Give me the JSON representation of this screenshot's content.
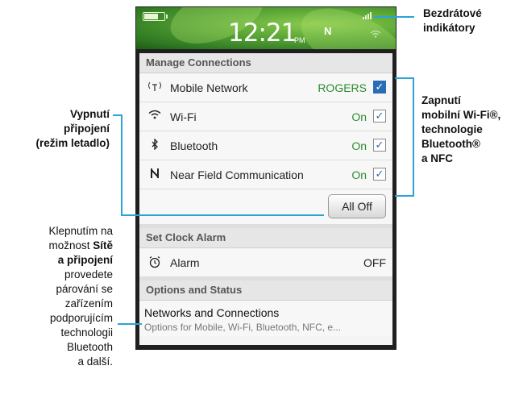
{
  "status_bar": {
    "time": "12:21",
    "ampm": "PM",
    "nfc_symbol": "N",
    "battery_level": 0.75
  },
  "manage_connections": {
    "header": "Manage Connections",
    "items": [
      {
        "icon": "antenna-icon",
        "label": "Mobile Network",
        "value": "ROGERS",
        "checked": true
      },
      {
        "icon": "wifi-icon",
        "label": "Wi-Fi",
        "value": "On",
        "checked": true
      },
      {
        "icon": "bluetooth-icon",
        "label": "Bluetooth",
        "value": "On",
        "checked": true
      },
      {
        "icon": "nfc-icon",
        "label": "Near Field Communication",
        "value": "On",
        "checked": true
      }
    ],
    "all_off_label": "All Off"
  },
  "clock_alarm": {
    "header": "Set Clock Alarm",
    "label": "Alarm",
    "value": "OFF"
  },
  "options": {
    "header": "Options and Status",
    "title": "Networks and Connections",
    "subtitle": "Options for Mobile, Wi-Fi, Bluetooth, NFC, e..."
  },
  "callouts": {
    "wireless_indicators": {
      "line1": "Bezdrátové",
      "line2": "indikátory"
    },
    "turn_on": {
      "line1": "Zapnutí",
      "line2": "mobilní Wi-Fi®,",
      "line3": "technologie",
      "line4": "Bluetooth®",
      "line5": "a NFC"
    },
    "turn_off": {
      "line1": "Vypnutí",
      "line2": "připojení",
      "line3": "(režim letadlo)"
    },
    "tap_hint": {
      "l1": "Klepnutím na",
      "l2a": "možnost ",
      "l2b": "Sítě",
      "l3": "a připojení",
      "l4": "provedete",
      "l5": "párování se",
      "l6": "zařízením",
      "l7": "podporujícím",
      "l8": "technologii",
      "l9": "Bluetooth",
      "l10": "a další."
    }
  },
  "colors": {
    "accent_line": "#2aa3d8",
    "on_green": "#2e8b2e",
    "checkbox_blue": "#2a6db5"
  }
}
